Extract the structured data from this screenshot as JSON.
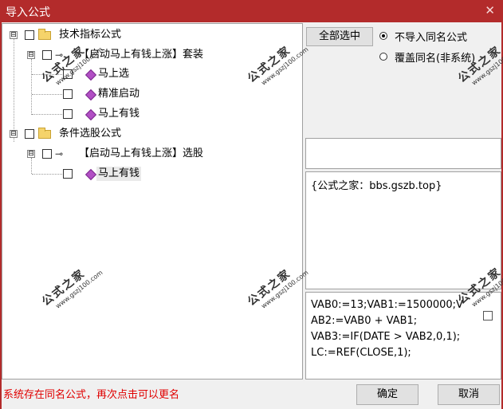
{
  "window": {
    "title": "导入公式",
    "close_glyph": "✕"
  },
  "tree": {
    "groups": [
      {
        "label": "技术指标公式",
        "expander": "⊟",
        "children": [
          {
            "label": "【启动马上有钱上涨】套装",
            "expander": "⊟",
            "items": [
              "马上选",
              "精准启动",
              "马上有钱"
            ]
          }
        ]
      },
      {
        "label": "条件选股公式",
        "expander": "⊟",
        "children": [
          {
            "label": "【启动马上有钱上涨】选股",
            "expander": "⊟",
            "items": [
              "马上有钱"
            ]
          }
        ]
      }
    ]
  },
  "options": {
    "select_all_label": "全部选中",
    "radios": [
      {
        "label": "不导入同名公式",
        "checked": true
      },
      {
        "label": "覆盖同名(非系统)",
        "checked": false
      }
    ]
  },
  "name_field": {
    "value": ""
  },
  "info": {
    "text": "{公式之家：bbs.gszb.top}"
  },
  "code": {
    "lines": [
      "VAB0:=13;VAB1:=1500000;V",
      "AB2:=VAB0 + VAB1;",
      "VAB3:=IF(DATE > VAB2,0,1);",
      "LC:=REF(CLOSE,1);"
    ]
  },
  "status": {
    "text": "系统存在同名公式，再次点击可以更名"
  },
  "buttons": {
    "ok": "确定",
    "cancel": "取消"
  },
  "watermark": {
    "text": "公式之家",
    "url": "www.gszj100.com"
  },
  "colors": {
    "titlebar": "#b32b2b",
    "status_text": "#e00000",
    "item_icon": "#b14fc4"
  }
}
